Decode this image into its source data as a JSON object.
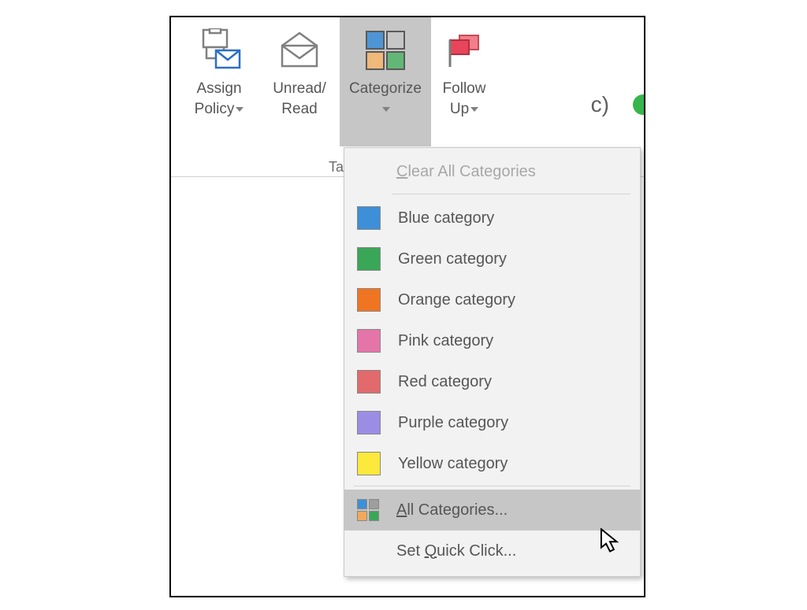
{
  "ribbon": {
    "assign": {
      "line1": "Assign",
      "line2": "Policy"
    },
    "unread": {
      "line1": "Unread/",
      "line2": "Read"
    },
    "categorize": {
      "line1": "Categorize"
    },
    "followup": {
      "line1": "Follow",
      "line2": "Up"
    },
    "group_label": "Ta"
  },
  "right_clip_text": "c)",
  "menu": {
    "clear": {
      "label": "Clear All Categories"
    },
    "items": [
      {
        "label": "Blue category",
        "color": "#3d8fd8"
      },
      {
        "label": "Green category",
        "color": "#39a757"
      },
      {
        "label": "Orange category",
        "color": "#f07522"
      },
      {
        "label": "Pink category",
        "color": "#e575a9"
      },
      {
        "label": "Red category",
        "color": "#e26a6c"
      },
      {
        "label": "Purple category",
        "color": "#9b8de4"
      },
      {
        "label": "Yellow category",
        "color": "#fce93b"
      }
    ],
    "all": {
      "label": "All Categories..."
    },
    "quick": {
      "label": "Set Quick Click..."
    }
  },
  "mini_grid_colors": {
    "a": "#3d8fd8",
    "b": "#9e9e9e",
    "c": "#f0a95b",
    "d": "#39a757"
  }
}
